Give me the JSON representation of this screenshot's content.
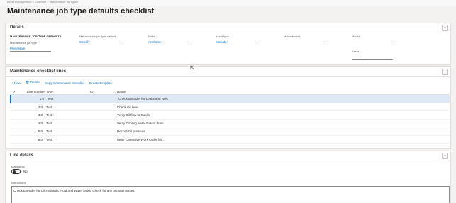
{
  "breadcrumb": "Asset management  >  Common  >  Maintenance job types",
  "page_title": "Maintenance job type defaults checklist",
  "details": {
    "title": "Details",
    "fields": [
      {
        "label": "MAINTENANCE JOB TYPE DEFAULTS",
        "value": ""
      },
      {
        "label": "Maintenance job type",
        "value": "Preventive"
      },
      {
        "label": "Maintenance job type variant",
        "value": "Weekly"
      },
      {
        "label": "Trade",
        "value": "Mechanic"
      },
      {
        "label": "Asset type",
        "value": "Extruder"
      },
      {
        "label": "Manufacturer",
        "value": ""
      },
      {
        "label": "Model",
        "value": ""
      },
      {
        "label": "Asset",
        "value": ""
      }
    ]
  },
  "checklist": {
    "title": "Maintenance checklist lines",
    "toolbar": [
      "+ New",
      "Delete",
      "Copy maintenance checklist",
      "Create template"
    ],
    "columns": [
      "Line number",
      "Type",
      "ID",
      "Name"
    ],
    "rows": [
      {
        "line": "1.0",
        "type": "Text",
        "id": "",
        "name": "Check Extruder for Leaks and Nois"
      },
      {
        "line": "2.0",
        "type": "Text",
        "id": "",
        "name": "Check Oil level"
      },
      {
        "line": "3.0",
        "type": "Text",
        "id": "",
        "name": "Verify Oil flow to Cooler"
      },
      {
        "line": "4.0",
        "type": "Text",
        "id": "",
        "name": "Verify Cooling water flow to drain"
      },
      {
        "line": "5.0",
        "type": "Text",
        "id": "",
        "name": "Record Oil pressure"
      },
      {
        "line": "6.0",
        "type": "Text",
        "id": "",
        "name": "Write Corrective Work Order for..."
      }
    ]
  },
  "line_details": {
    "title": "Line details",
    "mandatory_label": "Mandatory",
    "mandatory_value": "No",
    "instructions_label": "Instructions",
    "instructions_value": "Check Extruder for Oil,Hydraulic Fluid and Water leaks.  Check for any unusual noises."
  }
}
